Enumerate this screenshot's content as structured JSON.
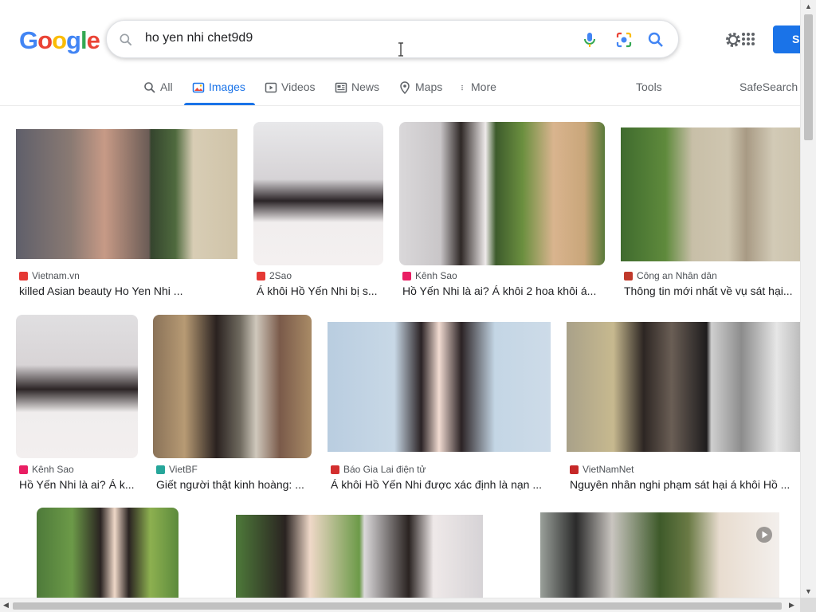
{
  "logo": {
    "letters": [
      "G",
      "o",
      "o",
      "g",
      "l",
      "e"
    ],
    "colors": [
      "#4285f4",
      "#ea4335",
      "#fbbc05",
      "#4285f4",
      "#34a853",
      "#ea4335"
    ]
  },
  "search": {
    "query": "ho yen nhi chet9d9"
  },
  "signin": {
    "label": "Si"
  },
  "tabs": [
    {
      "label": "All",
      "icon": "search-icon"
    },
    {
      "label": "Images",
      "icon": "image-icon"
    },
    {
      "label": "Videos",
      "icon": "video-icon"
    },
    {
      "label": "News",
      "icon": "news-icon"
    },
    {
      "label": "Maps",
      "icon": "map-pin-icon"
    },
    {
      "label": "More",
      "icon": "kebab-icon"
    },
    {
      "label": "Tools"
    },
    {
      "label": "SafeSearch"
    }
  ],
  "results": [
    {
      "source": "Vietnam.vn",
      "title": "killed Asian beauty Ho Yen Nhi ...",
      "fav_color": "#e53935"
    },
    {
      "source": "2Sao",
      "title": "Á khôi Hồ Yến Nhi bị s...",
      "fav_color": "#e53935"
    },
    {
      "source": "Kênh Sao",
      "title": "Hồ Yến Nhi là ai? Á khôi 2 hoa khôi á...",
      "fav_color": "#e91e63"
    },
    {
      "source": "Công an Nhân dân",
      "title": "Thông tin mới nhất về vụ sát hại...",
      "fav_color": "#c0392b"
    },
    {
      "source": "Kênh Sao",
      "title": "Hồ Yến Nhi là ai? Á k...",
      "fav_color": "#e91e63"
    },
    {
      "source": "VietBF",
      "title": "Giết người thật kinh hoàng: ...",
      "fav_color": "#26a69a"
    },
    {
      "source": "Báo Gia Lai điện tử",
      "title": "Á khôi Hồ Yến Nhi được xác định là nạn ...",
      "fav_color": "#d32f2f"
    },
    {
      "source": "VietNamNet",
      "title": "Nguyên nhân nghi phạm sát hại á khôi Hồ ...",
      "fav_color": "#c62828"
    }
  ]
}
